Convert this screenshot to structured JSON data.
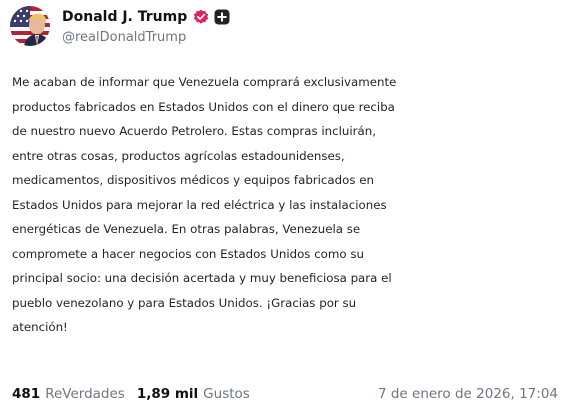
{
  "author": {
    "display_name": "Donald J. Trump",
    "handle": "@realDonaldTrump",
    "verified_badge_icon": "verified-badge-icon",
    "verified_badge_color": "#e0245e",
    "follow_icon": "plus-square-icon"
  },
  "post": {
    "text_lines": [
      "Me acaban de informar que Venezuela comprará exclusivamente",
      "productos fabricados en Estados Unidos con el dinero que reciba",
      "de nuestro nuevo Acuerdo Petrolero. Estas compras incluirán,",
      "entre otras cosas, productos agrícolas estadounidenses,",
      "medicamentos, dispositivos médicos y equipos fabricados en",
      "Estados Unidos para mejorar la red eléctrica y las instalaciones",
      "energéticas de Venezuela. En otras palabras, Venezuela se",
      "compromete a hacer negocios con Estados Unidos como su",
      "principal socio: una decisión acertada y muy beneficiosa para el",
      "pueblo venezolano y para Estados Unidos. ¡Gracias por su",
      "atención!"
    ]
  },
  "stats": {
    "reposts_count": "481",
    "reposts_label": "ReVerdades",
    "likes_count": "1,89 mil",
    "likes_label": "Gustos"
  },
  "timestamp": "7 de enero de 2026, 17:04"
}
